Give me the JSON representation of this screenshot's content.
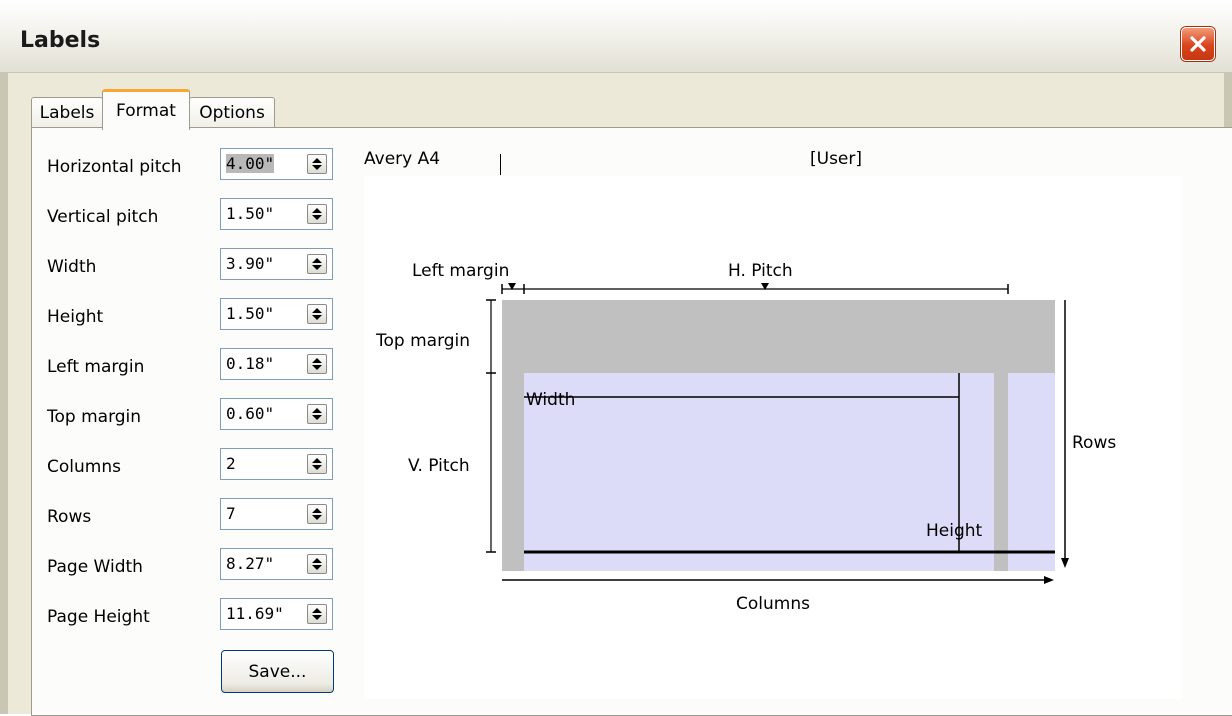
{
  "window": {
    "title": "Labels"
  },
  "tabs": [
    {
      "label": "Labels",
      "active": false
    },
    {
      "label": "Format",
      "active": true
    },
    {
      "label": "Options",
      "active": false
    }
  ],
  "fields": [
    {
      "label": "Horizontal pitch",
      "value": "4.00\""
    },
    {
      "label": "Vertical pitch",
      "value": "1.50\""
    },
    {
      "label": "Width",
      "value": "3.90\""
    },
    {
      "label": "Height",
      "value": "1.50\""
    },
    {
      "label": "Left margin",
      "value": "0.18\""
    },
    {
      "label": "Top margin",
      "value": "0.60\""
    },
    {
      "label": "Columns",
      "value": "2"
    },
    {
      "label": "Rows",
      "value": "7"
    },
    {
      "label": "Page Width",
      "value": "8.27\""
    },
    {
      "label": "Page Height",
      "value": "11.69\""
    }
  ],
  "save_button": "Save...",
  "preview": {
    "brand": "Avery A4",
    "type": "[User]",
    "left_margin": "Left margin",
    "h_pitch": "H. Pitch",
    "top_margin": "Top margin",
    "width": "Width",
    "v_pitch": "V. Pitch",
    "rows": "Rows",
    "height": "Height",
    "columns": "Columns"
  },
  "colors": {
    "accent_tab": "#f8a830",
    "page_gray": "#c0c0c0",
    "label_fill": "#dcdcf8",
    "close": "#d9441c"
  },
  "icons": {
    "close": "close-icon",
    "spin": "spin-updown-icon"
  }
}
